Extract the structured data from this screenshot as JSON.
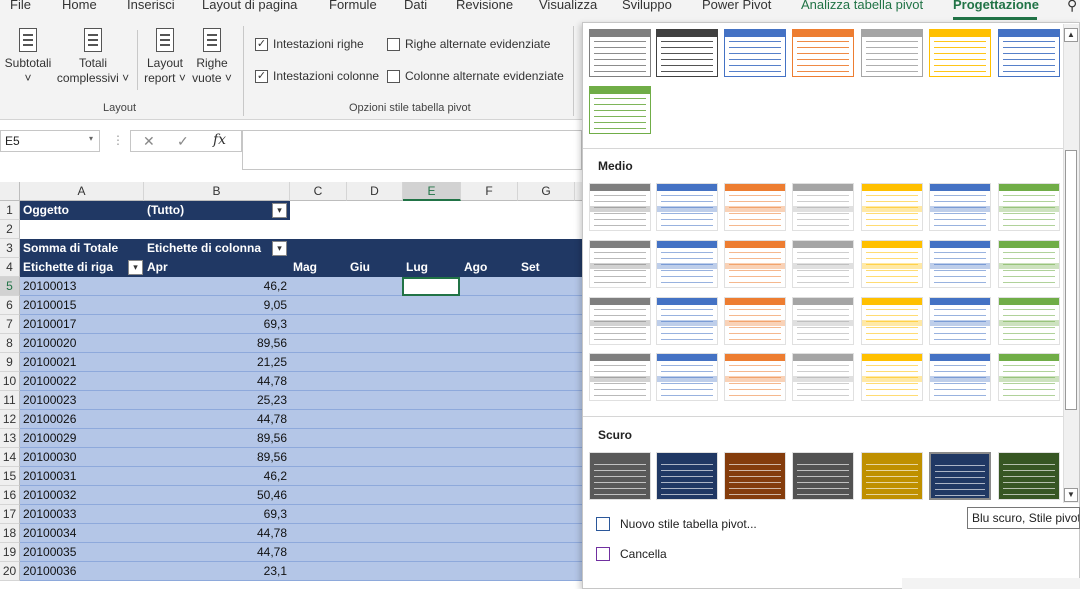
{
  "tabs": {
    "file": "File",
    "home": "Home",
    "insert": "Inserisci",
    "pagelayout": "Layout di pagina",
    "formulas": "Formule",
    "data": "Dati",
    "review": "Revisione",
    "view": "Visualizza",
    "developer": "Sviluppo",
    "powerpivot": "Power Pivot",
    "analyze": "Analizza tabella pivot",
    "design": "Progettazione"
  },
  "ribbon": {
    "subtotals": "Subtotali",
    "grand_totals_1": "Totali",
    "grand_totals_2": "complessivi ˅",
    "report_layout_1": "Layout",
    "report_layout_2": "report ˅",
    "blank_rows_1": "Righe",
    "blank_rows_2": "vuote ˅",
    "layout_group": "Layout",
    "row_headers": "Intestazioni righe",
    "col_headers": "Intestazioni colonne",
    "banded_rows": "Righe alternate evidenziate",
    "banded_cols": "Colonne alternate evidenziate",
    "options_group": "Opzioni stile tabella pivot",
    "row_headers_checked": true,
    "col_headers_checked": true,
    "check_mark": "✓"
  },
  "formula_bar": {
    "name_box": "E5",
    "cancel": "✕",
    "enter": "✓",
    "fx": "fx",
    "content": ""
  },
  "columns": [
    "A",
    "B",
    "C",
    "D",
    "E",
    "F",
    "G"
  ],
  "rows": [
    "1",
    "2",
    "3",
    "4",
    "5",
    "6",
    "7",
    "8",
    "9",
    "10",
    "11",
    "12",
    "13",
    "14",
    "15",
    "16",
    "17",
    "18",
    "19",
    "20"
  ],
  "pivot": {
    "filter_label": "Oggetto",
    "filter_value": "(Tutto)",
    "values_label": "Somma di Totale",
    "col_labels": "Etichette di colonna",
    "row_labels": "Etichette di riga",
    "months": [
      "Apr",
      "Mag",
      "Giu",
      "Lug",
      "Ago",
      "Set"
    ],
    "data_rows": [
      {
        "id": "20100013",
        "apr": "46,2"
      },
      {
        "id": "20100015",
        "apr": "9,05"
      },
      {
        "id": "20100017",
        "apr": "69,3"
      },
      {
        "id": "20100020",
        "apr": "89,56"
      },
      {
        "id": "20100021",
        "apr": "21,25"
      },
      {
        "id": "20100022",
        "apr": "44,78"
      },
      {
        "id": "20100023",
        "apr": "25,23"
      },
      {
        "id": "20100026",
        "apr": "44,78"
      },
      {
        "id": "20100029",
        "apr": "89,56"
      },
      {
        "id": "20100030",
        "apr": "89,56"
      },
      {
        "id": "20100031",
        "apr": "46,2"
      },
      {
        "id": "20100032",
        "apr": "50,46"
      },
      {
        "id": "20100033",
        "apr": "69,3"
      },
      {
        "id": "20100034",
        "apr": "44,78"
      },
      {
        "id": "20100035",
        "apr": "44,78"
      },
      {
        "id": "20100036",
        "apr": "23,1"
      }
    ]
  },
  "gallery": {
    "section_medium": "Medio",
    "section_dark": "Scuro",
    "new_style": "Nuovo stile tabella pivot...",
    "clear": "Cancella",
    "tooltip": "Blu scuro, Stile pivot",
    "light_colors": [
      "#7f7f7f",
      "#404040",
      "#4472c4",
      "#ed7d31",
      "#a5a5a5",
      "#ffc000",
      "#4472c4",
      "#70ad47"
    ],
    "medium_colors": [
      "#7f7f7f",
      "#4472c4",
      "#ed7d31",
      "#a5a5a5",
      "#ffc000",
      "#4472c4",
      "#70ad47"
    ],
    "dark_colors": [
      "#595959",
      "#203864",
      "#843c0c",
      "#525252",
      "#bf9000",
      "#203864",
      "#375623"
    ]
  },
  "accent": "#217346"
}
